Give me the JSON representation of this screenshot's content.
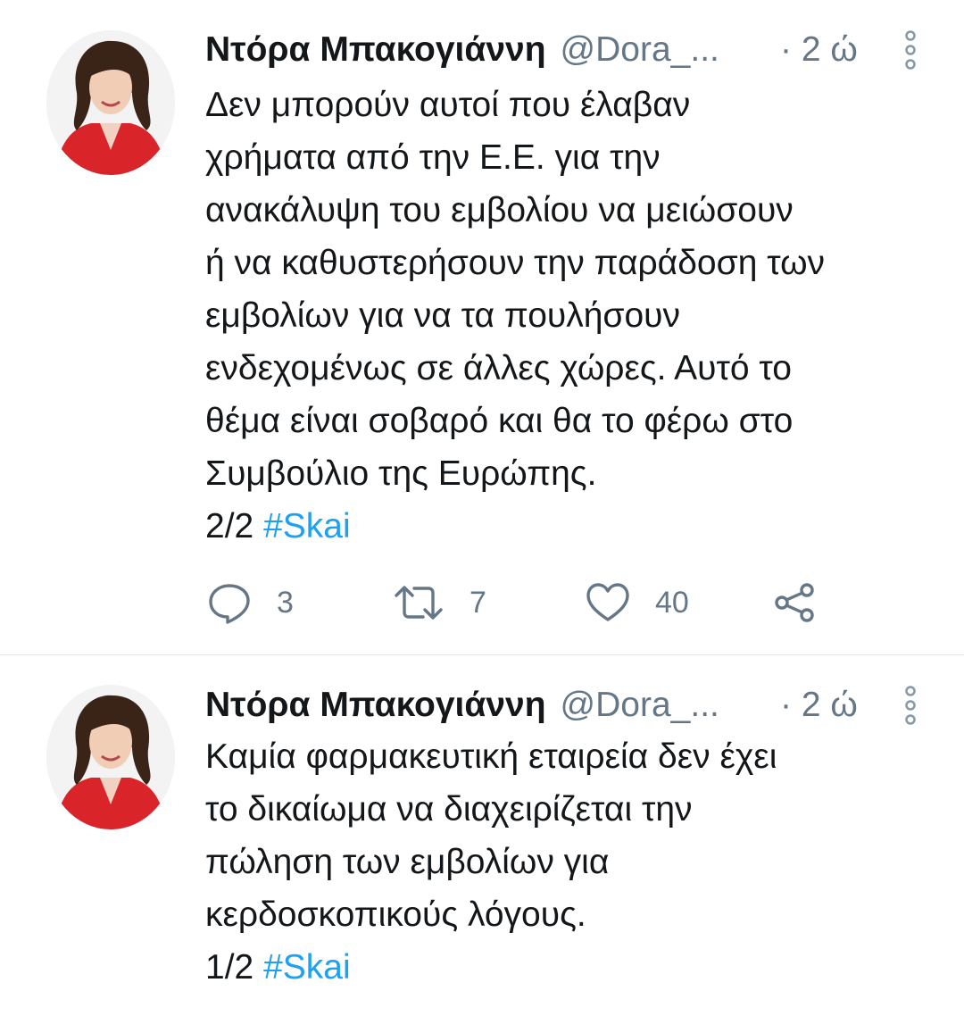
{
  "tweets": [
    {
      "author_name": "Ντόρα Μπακογιάννη",
      "handle": "@Dora_...",
      "time": "· 2 ώ",
      "text_lines": [
        "Δεν μπορούν αυτοί που έλαβαν",
        "χρήματα από την Ε.Ε. για την",
        "ανακάλυψη του εμβολίου να μειώσουν",
        "ή να καθυστερήσουν την παράδοση των",
        "εμβολίων για να τα πουλήσουν",
        "ενδεχομένως σε άλλες χώρες. Αυτό το",
        "θέμα είναι σοβαρό και θα το φέρω στο",
        "Συμβούλιο της Ευρώπης."
      ],
      "thread_marker": "2/2",
      "hashtag": "#Skai",
      "replies": "3",
      "retweets": "7",
      "likes": "40"
    },
    {
      "author_name": "Ντόρα Μπακογιάννη",
      "handle": "@Dora_...",
      "time": "· 2 ώ",
      "text_lines": [
        "Καμία φαρμακευτική εταιρεία δεν έχει",
        "το δικαίωμα να διαχειρίζεται την",
        "πώληση των εμβολίων για",
        "κερδοσκοπικούς λόγους."
      ],
      "thread_marker": "1/2",
      "hashtag": "#Skai"
    }
  ],
  "icons": {
    "reply": "reply-icon",
    "retweet": "retweet-icon",
    "like": "like-icon",
    "share": "share-icon",
    "more": "more-vertical-icon"
  },
  "colors": {
    "text": "#14171a",
    "secondary": "#657786",
    "hashtag": "#1da1f2",
    "divider": "#e1e4e8"
  }
}
